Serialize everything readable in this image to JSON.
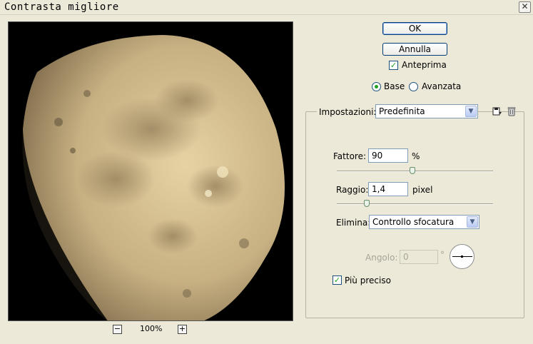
{
  "window": {
    "title": "Contrasta migliore"
  },
  "buttons": {
    "ok": "OK",
    "cancel": "Annulla"
  },
  "preview_toggle": {
    "label": "Anteprima",
    "checked": true
  },
  "mode": {
    "base": "Base",
    "advanced": "Avanzata",
    "selected": "base"
  },
  "settings": {
    "label": "Impostazioni:",
    "value": "Predefinita"
  },
  "amount": {
    "label": "Fattore:",
    "value": "90",
    "unit": "%",
    "slider_fraction": 0.45
  },
  "radius": {
    "label": "Raggio:",
    "value": "1,4",
    "unit": "pixel",
    "slider_fraction": 0.19
  },
  "remove": {
    "label": "Elimina:",
    "value": "Controllo sfocatura"
  },
  "angle": {
    "label": "Angolo:",
    "value": "0",
    "unit": "°"
  },
  "more_accurate": {
    "label": "Più preciso",
    "checked": true
  },
  "zoom": {
    "value": "100%",
    "minus": "−",
    "plus": "+"
  },
  "icons": {
    "save": "save-settings-icon",
    "delete": "trash-icon"
  }
}
